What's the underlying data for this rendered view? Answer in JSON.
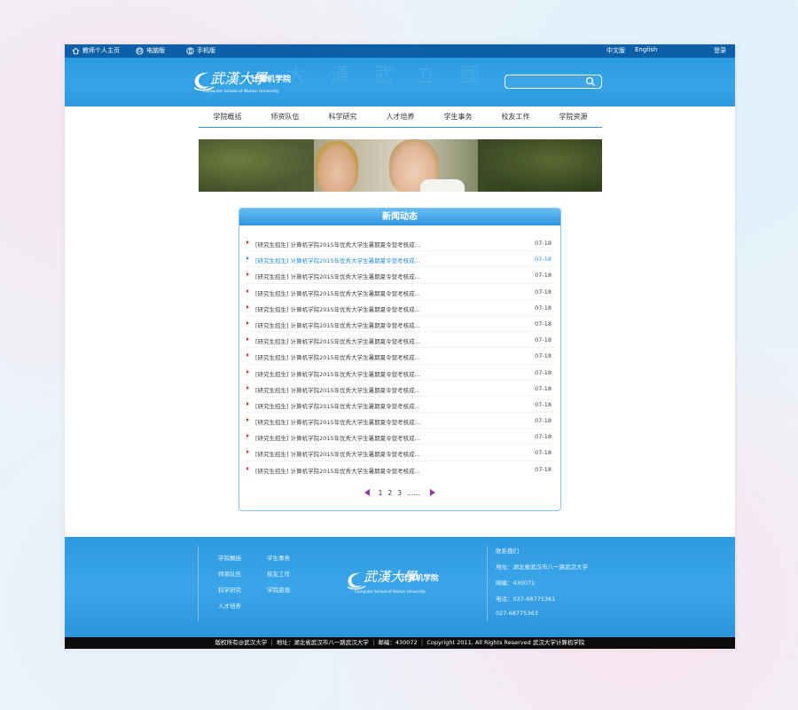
{
  "topbar": {
    "teacher_home": "教师个人主页",
    "pc_version": "电脑版",
    "mobile_version": "手机版",
    "chinese": "中文版",
    "english": "English",
    "login": "登录"
  },
  "header": {
    "watermark": "大 漢 武 立 國",
    "logo_calligraphy": "武漢大學",
    "logo_school": "计算机学院",
    "logo_en": "Computer School of Wuhan University",
    "search_placeholder": ""
  },
  "nav": [
    "学院概括",
    "师资队伍",
    "科学研究",
    "人才培养",
    "学生事务",
    "校友工作",
    "学院资源"
  ],
  "news": {
    "heading": "新闻动态",
    "items": [
      {
        "title": "[研究生招生] 计算机学院2015年优秀大学生暑期夏令营考核成...",
        "date": "07-18"
      },
      {
        "title": "[研究生招生] 计算机学院2015年优秀大学生暑期夏令营考核成...",
        "date": "07-18",
        "active": true
      },
      {
        "title": "[研究生招生] 计算机学院2015年优秀大学生暑期夏令营考核成...",
        "date": "07-18"
      },
      {
        "title": "[研究生招生] 计算机学院2015年优秀大学生暑期夏令营考核成...",
        "date": "07-18"
      },
      {
        "title": "[研究生招生] 计算机学院2015年优秀大学生暑期夏令营考核成...",
        "date": "07-18"
      },
      {
        "title": "[研究生招生] 计算机学院2015年优秀大学生暑期夏令营考核成...",
        "date": "07-18"
      },
      {
        "title": "[研究生招生] 计算机学院2015年优秀大学生暑期夏令营考核成...",
        "date": "07-18"
      },
      {
        "title": "[研究生招生] 计算机学院2015年优秀大学生暑期夏令营考核成...",
        "date": "07-18"
      },
      {
        "title": "[研究生招生] 计算机学院2015年优秀大学生暑期夏令营考核成...",
        "date": "07-18"
      },
      {
        "title": "[研究生招生] 计算机学院2015年优秀大学生暑期夏令营考核成...",
        "date": "07-18"
      },
      {
        "title": "[研究生招生] 计算机学院2015年优秀大学生暑期夏令营考核成...",
        "date": "07-18"
      },
      {
        "title": "[研究生招生] 计算机学院2015年优秀大学生暑期夏令营考核成...",
        "date": "07-18"
      },
      {
        "title": "[研究生招生] 计算机学院2015年优秀大学生暑期夏令营考核成...",
        "date": "07-18"
      },
      {
        "title": "[研究生招生] 计算机学院2015年优秀大学生暑期夏令营考核成...",
        "date": "07-18"
      },
      {
        "title": "[研究生招生] 计算机学院2015年优秀大学生暑期夏令营考核成...",
        "date": "07-18"
      }
    ],
    "pager": {
      "pages": [
        "1",
        "2",
        "3"
      ],
      "ellipsis": "......"
    }
  },
  "footer": {
    "links_col1": [
      "学院概括",
      "师资队伍",
      "科学研究",
      "人才培养"
    ],
    "links_col2": [
      "学生事务",
      "校友工作",
      "学院资源"
    ],
    "logo_calligraphy": "武漢大學",
    "logo_school": "计算机学院",
    "logo_en": "Computer School of Wuhan University",
    "contact_title": "联系我们",
    "address": "地址：湖北省武汉市八一路武汉大学",
    "postcode": "邮编：430072",
    "phone": "电话：027-68775361",
    "phone2": "027-68775363"
  },
  "copyright": "版权所有@武汉大学 ｜ 地址：湖北省武汉市八一路武汉大学 ｜ 邮编：430072 ｜ Copyright 2011, All Rights Reserved 武汉大学计算机学院",
  "colors": {
    "topbar": "#0d5fa7",
    "header": "#2d9be0",
    "accent_link": "#2d8fd6",
    "bullet": "#c4362c",
    "pager_arrow": "#8a3aa6"
  }
}
